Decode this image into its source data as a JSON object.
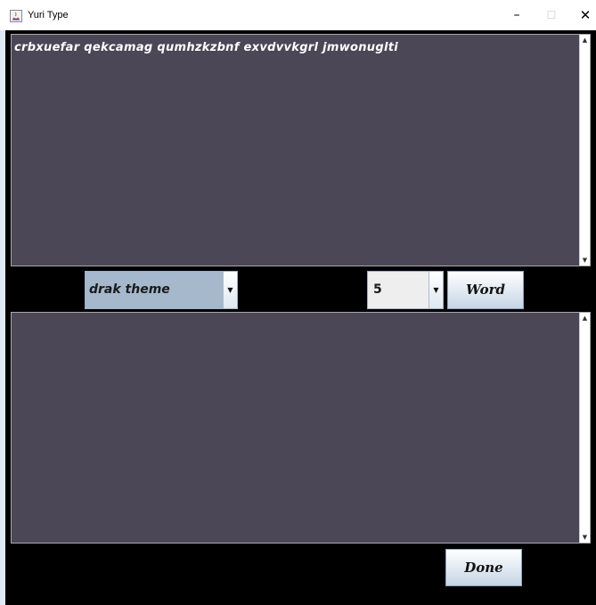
{
  "window": {
    "title": "Yuri Type",
    "minimize_glyph": "–",
    "maximize_glyph": "☐",
    "close_glyph": "✕",
    "app_icon": "java-app-icon"
  },
  "prompt_area": {
    "text": "crbxuefar qekcamag qumhzkzbnf exvdvvkgrl jmwonuglti",
    "scroll_up": "▲",
    "scroll_down": "▼"
  },
  "controls": {
    "theme_select": {
      "value": "drak theme",
      "arrow": "▼"
    },
    "count_select": {
      "value": "5",
      "arrow": "▼"
    },
    "word_button": "Word"
  },
  "input_area": {
    "text": "",
    "scroll_up": "▲",
    "scroll_down": "▼"
  },
  "footer": {
    "done_button": "Done"
  },
  "colors": {
    "text_area_bg": "#4b4756",
    "panel_bg": "#000000",
    "combo_theme_bg": "#a5b8cc"
  }
}
